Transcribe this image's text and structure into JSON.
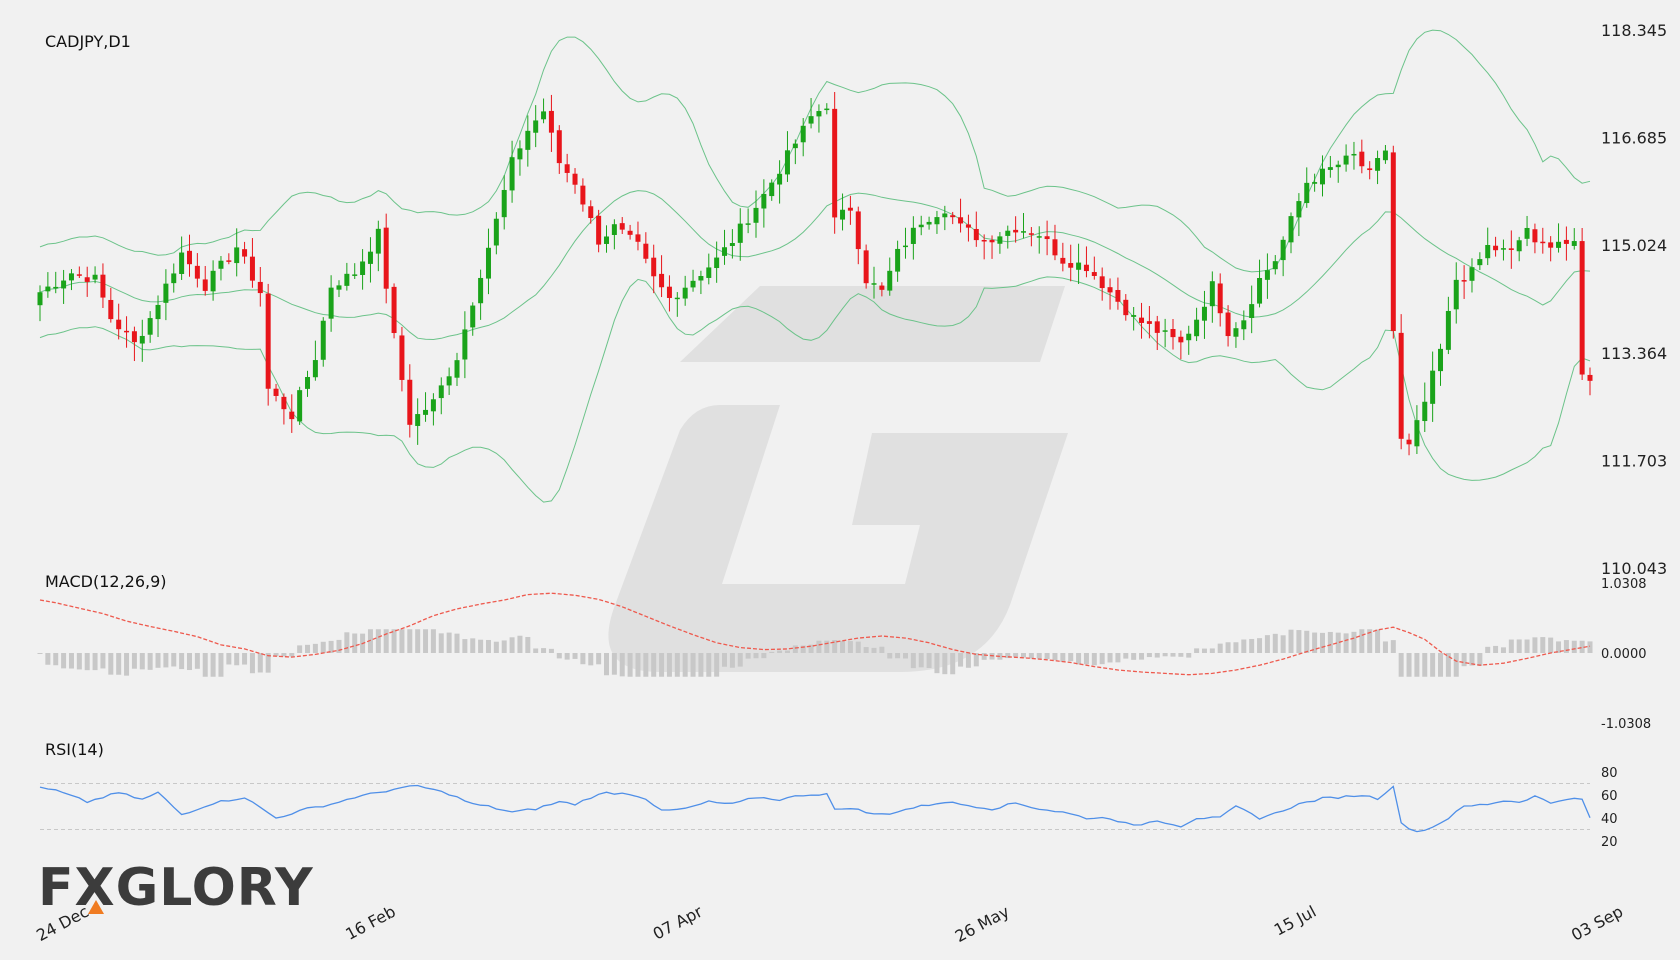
{
  "symbol_label": "CADJPY,D1",
  "macd_label": "MACD(12,26,9)",
  "rsi_label": "RSI(14)",
  "brand": "FXGLORY",
  "colors": {
    "up": "#1aa31a",
    "down": "#e8151b",
    "bands": "#6cc38a",
    "macd_signal": "#ee5a4e",
    "macd_hist": "#c8c8c8",
    "rsi": "#4f8fe8",
    "logo_accent": "#f07c22"
  },
  "chart_data": {
    "type": "candlestick",
    "price_axis": {
      "ticks": [
        "118.345",
        "116.685",
        "115.024",
        "113.364",
        "111.703",
        "110.043"
      ],
      "ylim": [
        110.043,
        118.345
      ]
    },
    "macd_axis": {
      "ticks": [
        "1.0308",
        "0.0000",
        "-1.0308"
      ],
      "ylim": [
        -1.0308,
        1.0308
      ]
    },
    "rsi_axis": {
      "ticks": [
        "80",
        "60",
        "40",
        "20"
      ],
      "levels": [
        70,
        30
      ]
    },
    "x_tick_labels": [
      "24 Dec",
      "16 Feb",
      "07 Apr",
      "26 May",
      "15 Jul",
      "03 Sep"
    ],
    "x_tick_index": [
      0,
      39,
      78,
      117,
      156,
      195
    ],
    "anchors": {
      "close": [
        [
          0,
          114.3
        ],
        [
          4,
          114.6
        ],
        [
          7,
          114.5
        ],
        [
          9,
          113.9
        ],
        [
          12,
          113.5
        ],
        [
          14,
          113.9
        ],
        [
          18,
          114.9
        ],
        [
          21,
          114.4
        ],
        [
          25,
          115.0
        ],
        [
          28,
          114.3
        ],
        [
          29,
          112.8
        ],
        [
          32,
          112.4
        ],
        [
          35,
          113.3
        ],
        [
          37,
          114.4
        ],
        [
          40,
          114.6
        ],
        [
          43,
          115.2
        ],
        [
          45,
          113.6
        ],
        [
          47,
          112.3
        ],
        [
          50,
          112.6
        ],
        [
          53,
          113.3
        ],
        [
          56,
          114.6
        ],
        [
          58,
          115.4
        ],
        [
          60,
          116.3
        ],
        [
          62,
          116.8
        ],
        [
          64,
          117.1
        ],
        [
          66,
          116.3
        ],
        [
          68,
          116.0
        ],
        [
          71,
          115.1
        ],
        [
          73,
          115.3
        ],
        [
          76,
          115.0
        ],
        [
          78,
          114.5
        ],
        [
          80,
          114.2
        ],
        [
          83,
          114.5
        ],
        [
          86,
          114.8
        ],
        [
          88,
          115.1
        ],
        [
          92,
          115.8
        ],
        [
          95,
          116.4
        ],
        [
          98,
          117.0
        ],
        [
          100,
          117.2
        ],
        [
          101,
          115.4
        ],
        [
          103,
          115.6
        ],
        [
          105,
          114.5
        ],
        [
          107,
          114.3
        ],
        [
          109,
          114.9
        ],
        [
          112,
          115.4
        ],
        [
          115,
          115.6
        ],
        [
          117,
          115.3
        ],
        [
          120,
          115.1
        ],
        [
          124,
          115.3
        ],
        [
          127,
          115.2
        ],
        [
          130,
          114.8
        ],
        [
          133,
          114.7
        ],
        [
          136,
          114.3
        ],
        [
          139,
          113.9
        ],
        [
          142,
          113.7
        ],
        [
          145,
          113.5
        ],
        [
          147,
          113.9
        ],
        [
          149,
          114.4
        ],
        [
          151,
          113.7
        ],
        [
          153,
          113.9
        ],
        [
          155,
          114.5
        ],
        [
          157,
          114.8
        ],
        [
          159,
          115.4
        ],
        [
          161,
          116.0
        ],
        [
          164,
          116.2
        ],
        [
          167,
          116.4
        ],
        [
          169,
          116.1
        ],
        [
          171,
          116.5
        ],
        [
          172,
          113.7
        ],
        [
          173,
          112.0
        ],
        [
          174,
          111.9
        ],
        [
          176,
          112.6
        ],
        [
          178,
          113.4
        ],
        [
          180,
          114.5
        ],
        [
          182,
          114.6
        ],
        [
          184,
          115.0
        ],
        [
          187,
          114.9
        ],
        [
          189,
          115.3
        ],
        [
          190,
          115.0
        ],
        [
          193,
          115.1
        ],
        [
          195,
          115.0
        ],
        [
          196,
          113.0
        ]
      ],
      "rsi": [
        [
          0,
          66
        ],
        [
          2,
          64
        ],
        [
          6,
          54
        ],
        [
          10,
          62
        ],
        [
          13,
          56
        ],
        [
          15,
          62
        ],
        [
          18,
          43
        ],
        [
          22,
          53
        ],
        [
          26,
          58
        ],
        [
          30,
          40
        ],
        [
          34,
          48
        ],
        [
          37,
          52
        ],
        [
          40,
          58
        ],
        [
          45,
          65
        ],
        [
          48,
          68
        ],
        [
          52,
          61
        ],
        [
          55,
          52
        ],
        [
          57,
          50
        ],
        [
          60,
          45
        ],
        [
          63,
          48
        ],
        [
          66,
          54
        ],
        [
          68,
          52
        ],
        [
          70,
          58
        ],
        [
          72,
          62
        ],
        [
          75,
          61
        ],
        [
          77,
          57
        ],
        [
          79,
          46
        ],
        [
          82,
          48
        ],
        [
          85,
          54
        ],
        [
          88,
          52
        ],
        [
          91,
          58
        ],
        [
          94,
          56
        ],
        [
          97,
          60
        ],
        [
          100,
          61
        ],
        [
          101,
          47
        ],
        [
          103,
          49
        ],
        [
          106,
          43
        ],
        [
          108,
          44
        ],
        [
          111,
          49
        ],
        [
          115,
          54
        ],
        [
          118,
          51
        ],
        [
          121,
          48
        ],
        [
          124,
          53
        ],
        [
          127,
          48
        ],
        [
          130,
          45
        ],
        [
          133,
          40
        ],
        [
          136,
          40
        ],
        [
          139,
          33
        ],
        [
          142,
          38
        ],
        [
          145,
          33
        ],
        [
          147,
          40
        ],
        [
          150,
          40
        ],
        [
          152,
          50
        ],
        [
          155,
          40
        ],
        [
          157,
          44
        ],
        [
          160,
          52
        ],
        [
          163,
          57
        ],
        [
          165,
          58
        ],
        [
          168,
          60
        ],
        [
          170,
          57
        ],
        [
          172,
          68
        ],
        [
          173,
          35
        ],
        [
          175,
          28
        ],
        [
          177,
          32
        ],
        [
          179,
          40
        ],
        [
          181,
          50
        ],
        [
          184,
          52
        ],
        [
          186,
          55
        ],
        [
          188,
          54
        ],
        [
          190,
          59
        ],
        [
          192,
          53
        ],
        [
          194,
          57
        ],
        [
          196,
          56
        ],
        [
          197,
          40
        ]
      ],
      "macd": [
        [
          0,
          0.78
        ],
        [
          2,
          0.74
        ],
        [
          5,
          0.66
        ],
        [
          8,
          0.58
        ],
        [
          11,
          0.47
        ],
        [
          14,
          0.39
        ],
        [
          17,
          0.32
        ],
        [
          20,
          0.24
        ],
        [
          23,
          0.12
        ],
        [
          26,
          0.06
        ],
        [
          29,
          -0.04
        ],
        [
          32,
          -0.06
        ],
        [
          35,
          -0.02
        ],
        [
          38,
          0.04
        ],
        [
          41,
          0.14
        ],
        [
          44,
          0.28
        ],
        [
          47,
          0.4
        ],
        [
          50,
          0.55
        ],
        [
          53,
          0.65
        ],
        [
          56,
          0.72
        ],
        [
          59,
          0.78
        ],
        [
          62,
          0.86
        ],
        [
          65,
          0.88
        ],
        [
          68,
          0.85
        ],
        [
          71,
          0.79
        ],
        [
          74,
          0.68
        ],
        [
          77,
          0.54
        ],
        [
          80,
          0.4
        ],
        [
          83,
          0.27
        ],
        [
          86,
          0.15
        ],
        [
          89,
          0.08
        ],
        [
          92,
          0.05
        ],
        [
          95,
          0.06
        ],
        [
          98,
          0.1
        ],
        [
          101,
          0.16
        ],
        [
          104,
          0.22
        ],
        [
          107,
          0.25
        ],
        [
          110,
          0.22
        ],
        [
          113,
          0.15
        ],
        [
          116,
          0.05
        ],
        [
          119,
          -0.02
        ],
        [
          122,
          -0.05
        ],
        [
          125,
          -0.07
        ],
        [
          128,
          -0.1
        ],
        [
          131,
          -0.14
        ],
        [
          134,
          -0.2
        ],
        [
          137,
          -0.25
        ],
        [
          140,
          -0.28
        ],
        [
          143,
          -0.3
        ],
        [
          146,
          -0.32
        ],
        [
          149,
          -0.3
        ],
        [
          152,
          -0.25
        ],
        [
          155,
          -0.18
        ],
        [
          158,
          -0.09
        ],
        [
          161,
          0.02
        ],
        [
          164,
          0.12
        ],
        [
          167,
          0.22
        ],
        [
          170,
          0.34
        ],
        [
          172,
          0.38
        ],
        [
          174,
          0.3
        ],
        [
          176,
          0.2
        ],
        [
          178,
          0.02
        ],
        [
          180,
          -0.12
        ],
        [
          183,
          -0.18
        ],
        [
          186,
          -0.15
        ],
        [
          189,
          -0.08
        ],
        [
          192,
          0.0
        ],
        [
          195,
          0.06
        ],
        [
          197,
          0.1
        ]
      ]
    }
  }
}
